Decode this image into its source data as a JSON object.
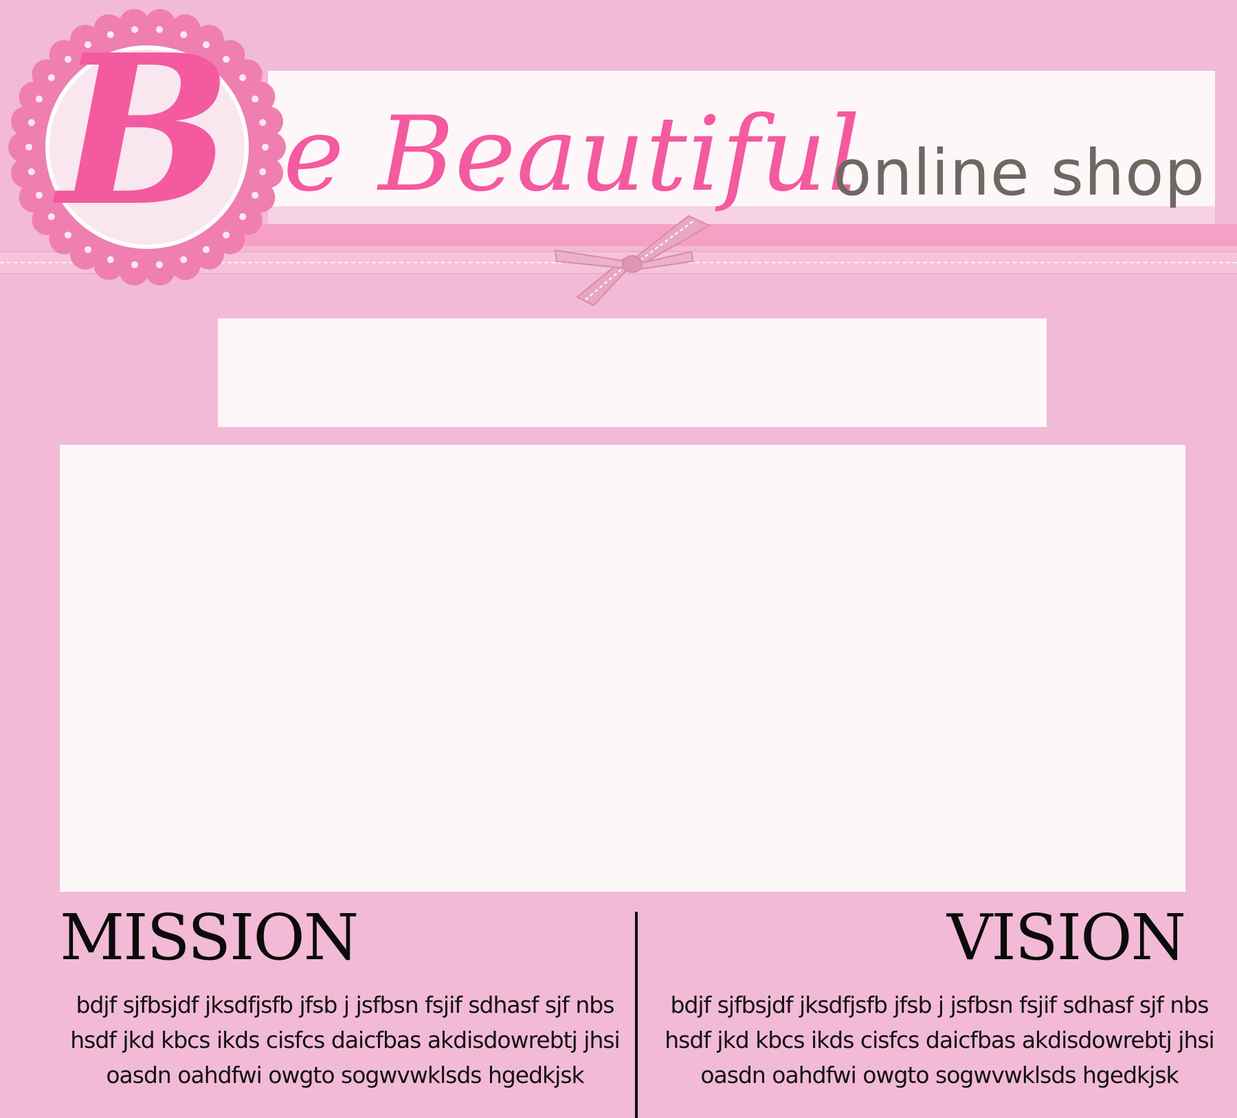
{
  "brand": {
    "initial": "B",
    "name_rest": "e Beautiful",
    "tagline": "online shop",
    "accent_color": "#f45a9f",
    "background_color": "#f2bad6"
  },
  "icons": {
    "logo_badge": "scalloped-circle-icon",
    "ribbon_bow": "bow-icon"
  },
  "mission": {
    "heading": "MISSION",
    "body": "bdjf sjfbsjdf jksdfjsfb jfsb j  jsfbsn fsjif sdhasf sjf nbs hsdf jkd kbcs ikds cisfcs daicfbas akdisdowrebtj jhsi oasdn oahdfwi owgto sogwvwklsds hgedkjsk"
  },
  "vision": {
    "heading": "VISION",
    "body": "bdjf sjfbsjdf jksdfjsfb jfsb j  jsfbsn fsjif sdhasf sjf nbs hsdf jkd kbcs ikds cisfcs daicfbas akdisdowrebtj jhsi oasdn oahdfwi owgto sogwvwklsds hgedkjsk"
  }
}
